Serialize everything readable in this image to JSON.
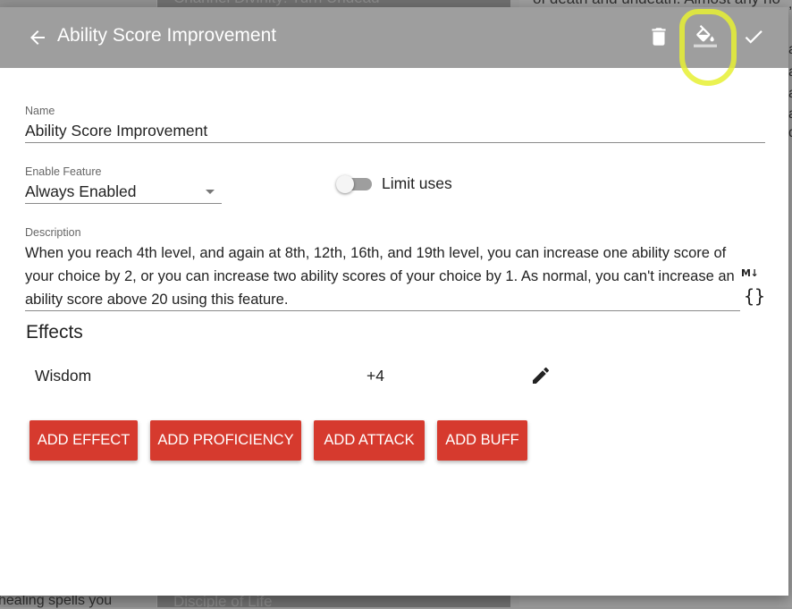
{
  "background": {
    "card_top_title": "Channel Divinity: Turn Undead",
    "right_text_top": "of death and undeath. Almost any ho",
    "bottom_left_text": "healing spells you",
    "card_bottom_title": "Disciple of Life",
    "right_edge_fragments": [
      ",",
      "a",
      "a",
      "a",
      "a",
      "d",
      "i",
      "a",
      "i",
      "e",
      "w"
    ]
  },
  "toolbar": {
    "title": "Ability Score Improvement",
    "icons": [
      "arrow-back-icon",
      "trash-icon",
      "paint-bucket-icon",
      "check-icon"
    ]
  },
  "form": {
    "name_label": "Name",
    "name_value": "Ability Score Improvement",
    "enable_label": "Enable Feature",
    "enable_value": "Always Enabled",
    "limit_uses_label": "Limit uses",
    "limit_uses_on": false,
    "description_label": "Description",
    "description_value": "When you reach 4th level, and again at 8th, 12th, 16th, and 19th level, you can increase one ability score of your choice by 2, or you can increase two ability scores of your choice by 1. As normal, you can't increase an ability score above 20 using this feature.",
    "markdown_icon_text": "M↓",
    "braces_icon_text": "{}"
  },
  "effects": {
    "title": "Effects",
    "rows": [
      {
        "name": "Wisdom",
        "value": "+4"
      }
    ]
  },
  "buttons": {
    "add_effect": "ADD EFFECT",
    "add_proficiency": "ADD PROFICIENCY",
    "add_attack": "ADD ATTACK",
    "add_buff": "ADD BUFF"
  },
  "colors": {
    "toolbar": "#9e9e9e",
    "button": "#d63a2e",
    "highlight": "#e6f032"
  }
}
